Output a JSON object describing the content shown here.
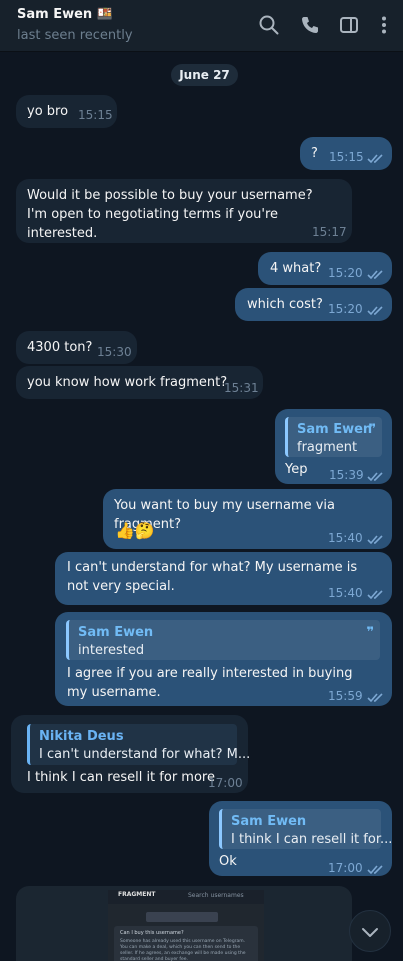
{
  "header": {
    "name": "Sam Ewen 🍱",
    "status": "last seen recently"
  },
  "date_label": "June 27",
  "messages": [
    {
      "dir": "in",
      "text": "yo bro",
      "time": "15:15"
    },
    {
      "dir": "out",
      "text": "?",
      "time": "15:15"
    },
    {
      "dir": "in",
      "text": "Would it be possible to buy your username? I'm open to negotiating terms if you're interested.",
      "time": "15:17"
    },
    {
      "dir": "out",
      "text": "4 what?",
      "time": "15:20"
    },
    {
      "dir": "out",
      "text": "which cost?",
      "time": "15:20"
    },
    {
      "dir": "in",
      "text": "4300 ton?",
      "time": "15:30"
    },
    {
      "dir": "in",
      "text": "you know how work fragment?",
      "time": "15:31"
    },
    {
      "dir": "out",
      "quote_name": "Sam Ewen",
      "quote_text": "fragment",
      "text": "Yep",
      "time": "15:39"
    },
    {
      "dir": "out",
      "text": "You want to buy my username via fragment?",
      "reactions": "👍🤔",
      "time": "15:40"
    },
    {
      "dir": "out",
      "text": "I can't understand for what? My username is not very special.",
      "time": "15:40"
    },
    {
      "dir": "out",
      "quote_name": "Sam Ewen",
      "quote_text": "interested",
      "text": "I agree if you are really interested in buying my username.",
      "time": "15:59"
    },
    {
      "dir": "in",
      "quote_name": "Nikita Deus",
      "quote_text": "I can't understand for what? M...",
      "text": "I think I can resell it for more",
      "time": "17:00"
    },
    {
      "dir": "out",
      "quote_name": "Sam Ewen",
      "quote_text": "I think I can resell it for...",
      "text": "Ok",
      "time": "17:00"
    }
  ],
  "screenshot_preview": {
    "brand": "FRAGMENT",
    "search_placeholder": "Search usernames",
    "card_title": "Can I buy this username?",
    "card_text": "Someone has already used this username on Telegram. You can make a deal, which you can then send to the seller. If he agrees, an exchange will be made using the standard seller and buyer fee."
  },
  "icons": {
    "header": [
      "search-icon",
      "phone-icon",
      "sidebar-toggle-icon",
      "more-vertical-icon"
    ],
    "read_receipt": "double-check-icon",
    "scroll_down": "chevron-down-icon"
  },
  "colors": {
    "background": "#0e1621",
    "incoming_bubble": "#182533",
    "outgoing_bubble": "#2b5278",
    "accent": "#6ab3f3"
  }
}
